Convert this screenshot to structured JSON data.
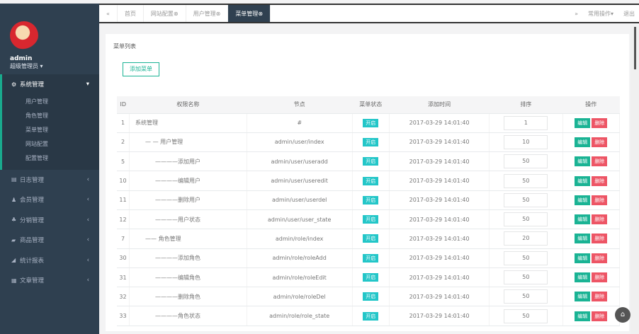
{
  "user": {
    "name": "admin",
    "role": "超级管理员"
  },
  "sidebar": {
    "active": {
      "label": "系统管理",
      "subs": [
        "用户管理",
        "角色管理",
        "菜单管理",
        "网站配置",
        "配置管理"
      ]
    },
    "items": [
      {
        "label": "日志管理",
        "icon": "calendar-icon"
      },
      {
        "label": "会员管理",
        "icon": "user-icon"
      },
      {
        "label": "分销管理",
        "icon": "users-icon"
      },
      {
        "label": "商品管理",
        "icon": "book-icon"
      },
      {
        "label": "统计报表",
        "icon": "chart-icon"
      },
      {
        "label": "文章管理",
        "icon": "list-icon"
      }
    ]
  },
  "tabs": [
    "首页",
    "网站配置",
    "用户管理",
    "菜单管理"
  ],
  "topright": {
    "ops": "常用操作",
    "logout": "退出"
  },
  "panel": {
    "title": "菜单列表",
    "add": "添加菜单"
  },
  "table": {
    "headers": [
      "ID",
      "权限名称",
      "节点",
      "菜单状态",
      "添加时间",
      "排序",
      "操作"
    ],
    "status": "开启",
    "edit": "编辑",
    "del": "删除",
    "rows": [
      {
        "id": "1",
        "name": "系统管理",
        "node": "#",
        "time": "2017-03-29 14:01:40",
        "sort": "1",
        "indent": 0
      },
      {
        "id": "2",
        "name": "— — 用户管理",
        "node": "admin/user/index",
        "time": "2017-03-29 14:01:40",
        "sort": "10",
        "indent": 1
      },
      {
        "id": "5",
        "name": "————添加用户",
        "node": "admin/user/useradd",
        "time": "2017-03-29 14:01:40",
        "sort": "50",
        "indent": 2
      },
      {
        "id": "10",
        "name": "————编辑用户",
        "node": "admin/user/useredit",
        "time": "2017-03-29 14:01:40",
        "sort": "50",
        "indent": 2
      },
      {
        "id": "11",
        "name": "————删除用户",
        "node": "admin/user/userdel",
        "time": "2017-03-29 14:01:40",
        "sort": "50",
        "indent": 2
      },
      {
        "id": "12",
        "name": "————用户状态",
        "node": "admin/user/user_state",
        "time": "2017-03-29 14:01:40",
        "sort": "50",
        "indent": 2
      },
      {
        "id": "7",
        "name": "—— 角色管理",
        "node": "admin/role/index",
        "time": "2017-03-29 14:01:40",
        "sort": "20",
        "indent": 1
      },
      {
        "id": "30",
        "name": "————添加角色",
        "node": "admin/role/roleAdd",
        "time": "2017-03-29 14:01:40",
        "sort": "50",
        "indent": 2
      },
      {
        "id": "31",
        "name": "————编辑角色",
        "node": "admin/role/roleEdit",
        "time": "2017-03-29 14:01:40",
        "sort": "50",
        "indent": 2
      },
      {
        "id": "32",
        "name": "————删除角色",
        "node": "admin/role/roleDel",
        "time": "2017-03-29 14:01:40",
        "sort": "50",
        "indent": 2
      },
      {
        "id": "33",
        "name": "————角色状态",
        "node": "admin/role/role_state",
        "time": "2017-03-29 14:01:40",
        "sort": "50",
        "indent": 2
      }
    ]
  }
}
